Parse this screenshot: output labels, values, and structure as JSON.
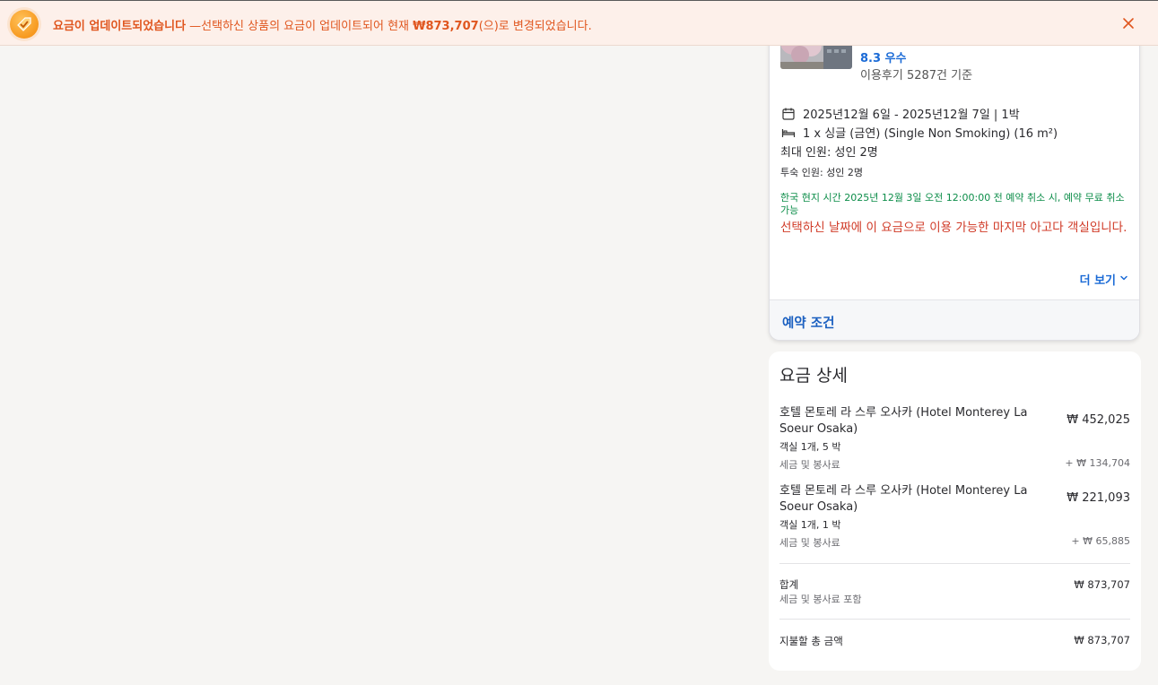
{
  "banner": {
    "title": "요금이 업데이트되었습니다",
    "message_prefix": " —선택하신 상품의 요금이 업데이트되어 현재 ",
    "new_price": "₩873,707",
    "message_suffix": "(으)로 변경되었습니다.",
    "colors": {
      "background": "#fdf0ea",
      "text": "#e0561f"
    }
  },
  "booking": {
    "rating": "8.3 우수",
    "review_count": "이용후기 5287건 기준",
    "dates": "2025년12월 6일 - 2025년12월 7일 | 1박",
    "room": "1 x 싱글 (금연) (Single Non Smoking) (16 m²)",
    "max_guests": "최대 인원: 성인 2명",
    "guests": "투숙 인원: 성인 2명",
    "cancellation": "한국 현지 시간 2025년 12월 3일 오전 12:00:00 전 예약 취소 시, 예약 무료 취소 가능",
    "scarcity": "선택하신 날짜에 이 요금으로 이용 가능한 마지막 아고다 객실입니다.",
    "more_label": "더 보기",
    "terms_label": "예약 조건"
  },
  "price_details": {
    "title": "요금 상세",
    "items": [
      {
        "name": "호텔 몬토레 라 스루 오사카 (Hotel Monterey La Soeur Osaka)",
        "price": "₩ 452,025",
        "sub": "객실 1개, 5 박",
        "tax_label": "세금 및 봉사료",
        "tax_value": "+ ₩ 134,704"
      },
      {
        "name": "호텔 몬토레 라 스루 오사카 (Hotel Monterey La Soeur Osaka)",
        "price": "₩ 221,093",
        "sub": "객실 1개, 1 박",
        "tax_label": "세금 및 봉사료",
        "tax_value": "+ ₩ 65,885"
      }
    ],
    "total_label": "합계",
    "total_sub": "세금 및 봉사료 포함",
    "total_value": "₩ 873,707",
    "pay_label": "지불할 총 금액",
    "pay_value": "₩ 873,707"
  },
  "icons": {
    "banner": "price-tag-check-icon",
    "close": "close-icon",
    "calendar": "calendar-icon",
    "bed": "bed-icon",
    "chevron": "chevron-down-icon"
  },
  "colors": {
    "link_blue": "#1a6ad6",
    "green": "#0c8d49",
    "red": "#d03a27",
    "page_bg": "#f6f5f3"
  }
}
